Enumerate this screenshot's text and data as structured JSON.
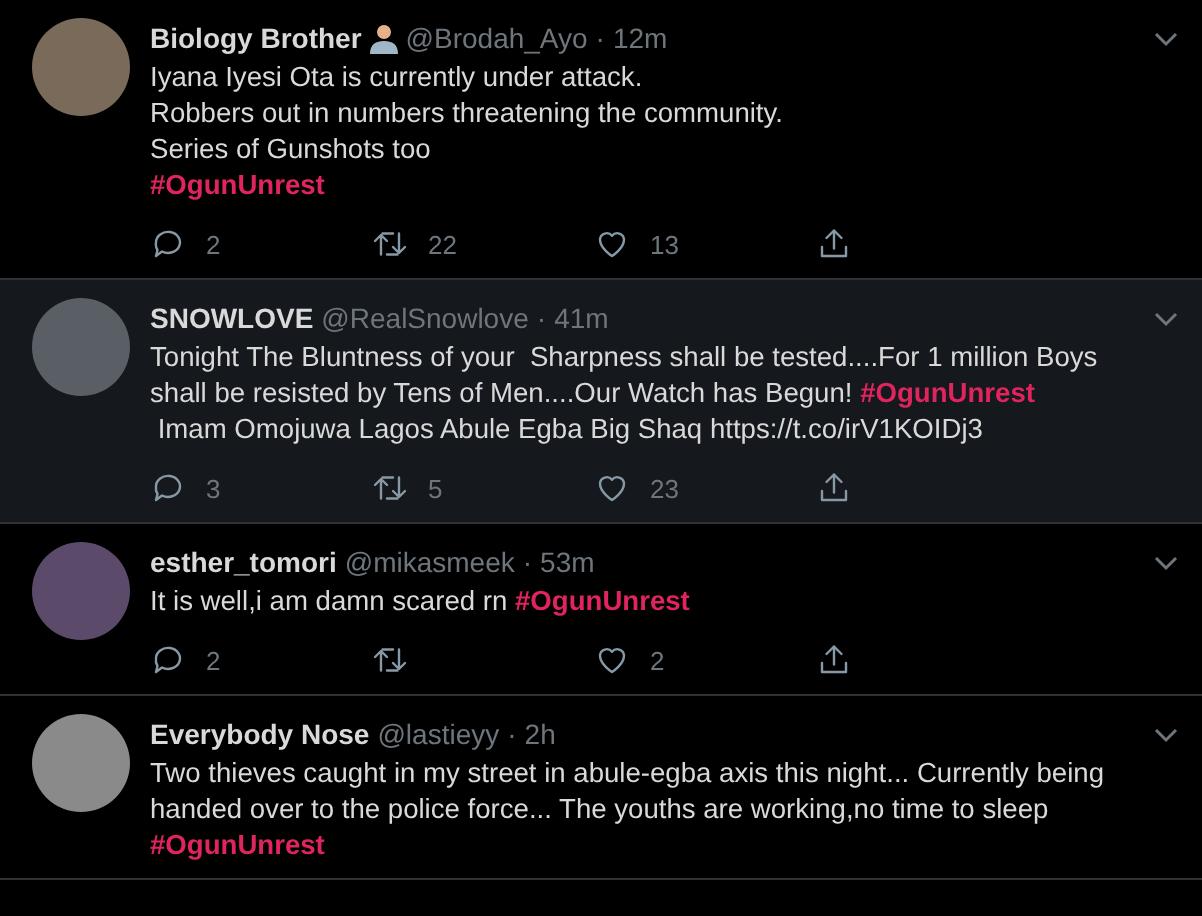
{
  "tweets": [
    {
      "name": "Biology Brother",
      "name_emoji": true,
      "handle": "@Brodah_Ayo",
      "separator": "·",
      "time": "12m",
      "highlighted": false,
      "body": [
        {
          "kind": "plain",
          "text": "Iyana Iyesi Ota is currently under attack.\nRobbers out in numbers threatening the community.\nSeries of Gunshots too\n"
        },
        {
          "kind": "hashtag",
          "text": "#OgunUnrest"
        }
      ],
      "replies": "2",
      "retweets": "22",
      "likes": "13"
    },
    {
      "name": "SNOWLOVE",
      "handle": "@RealSnowlove",
      "separator": "·",
      "time": "41m",
      "highlighted": true,
      "body": [
        {
          "kind": "plain",
          "text": "Tonight The Bluntness of your  Sharpness shall be tested....For 1 million Boys shall be resisted by Tens of Men....Our Watch has Begun! "
        },
        {
          "kind": "hashtag",
          "text": "#OgunUnrest"
        },
        {
          "kind": "plain",
          "text": "\n Imam Omojuwa Lagos Abule Egba Big Shaq https://t.co/irV1KOIDj3"
        }
      ],
      "replies": "3",
      "retweets": "5",
      "likes": "23"
    },
    {
      "name": "esther_tomori",
      "handle": "@mikasmeek",
      "separator": "·",
      "time": "53m",
      "highlighted": false,
      "body": [
        {
          "kind": "plain",
          "text": "It is well,i am damn scared rn "
        },
        {
          "kind": "hashtag",
          "text": "#OgunUnrest"
        }
      ],
      "replies": "2",
      "likes": "2"
    },
    {
      "name": "Everybody Nose",
      "handle": "@lastieyy",
      "separator": "·",
      "time": "2h",
      "highlighted": false,
      "body": [
        {
          "kind": "plain",
          "text": "Two thieves caught in my street in abule-egba axis this night... Currently being handed over to the police force... The youths are working,no time to sleep "
        },
        {
          "kind": "hashtag",
          "text": "#OgunUnrest"
        }
      ]
    }
  ]
}
